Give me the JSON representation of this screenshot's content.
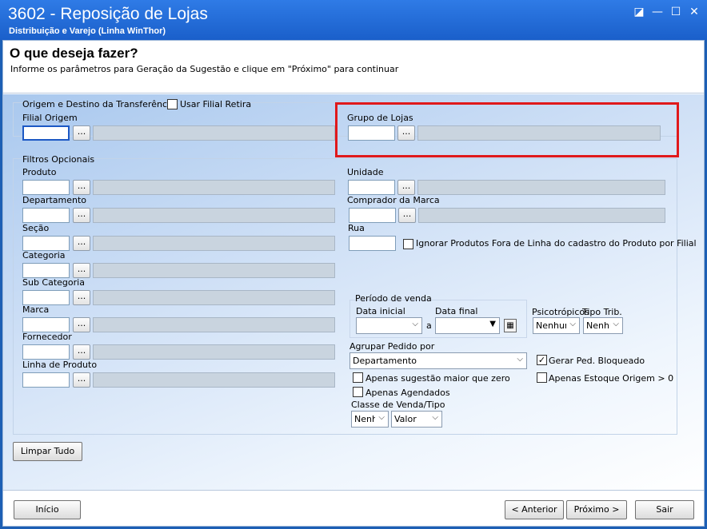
{
  "window": {
    "title": "3602 - Reposição de Lojas",
    "subtitle": "Distribuição e Varejo (Linha WinThor)",
    "icons": [
      "restore-icon",
      "minimize-icon",
      "maximize-icon",
      "close-icon"
    ],
    "glyphs": {
      "restore": "◪",
      "minimize": "—",
      "maximize": "☐",
      "close": "✕"
    }
  },
  "header": {
    "heading": "O que deseja fazer?",
    "instruction": "Informe os parâmetros para Geração da Sugestão e clique em \"Próximo\" para continuar"
  },
  "origem": {
    "group_title": "Origem e Destino da Transferência",
    "usar_filial_retira": "Usar Filial Retira",
    "filial_origem_label": "Filial Origem"
  },
  "grupo_lojas": {
    "label": "Grupo de Lojas"
  },
  "filtros": {
    "group_title": "Filtros Opcionais",
    "left_fields": [
      "Produto",
      "Departamento",
      "Seção",
      "Categoria",
      "Sub Categoria",
      "Marca",
      "Fornecedor",
      "Linha de Produto"
    ],
    "unidade": "Unidade",
    "comprador": "Comprador da Marca",
    "rua": "Rua",
    "ignorar": "Ignorar Produtos Fora de Linha do cadastro do Produto por Filial",
    "periodo": {
      "title": "Período de venda",
      "data_inicial": "Data inicial",
      "a": "a",
      "data_final": "Data final"
    },
    "psicotropicos": {
      "label": "Psicotrópicos",
      "value": "Nenhum"
    },
    "tipo_trib": {
      "label": "Tipo Trib.",
      "value": "Nenhum"
    },
    "agrupar": {
      "label": "Agrupar Pedido por",
      "value": "Departamento"
    },
    "gerar_ped_bloqueado": {
      "label": "Gerar Ped. Bloqueado",
      "checked": true
    },
    "apenas_sugestao": "Apenas sugestão maior que zero",
    "apenas_estoque": "Apenas Estoque Origem > 0",
    "apenas_agendados": "Apenas Agendados",
    "classe_venda": {
      "label": "Classe de Venda/Tipo",
      "value1": "Nenhum",
      "value2": "Valor"
    }
  },
  "dots": "...",
  "check_mark": "✓",
  "limpar_tudo": "Limpar Tudo",
  "footer": {
    "inicio": "Início",
    "anterior": "< Anterior",
    "proximo": "Próximo >",
    "sair": "Sair"
  }
}
